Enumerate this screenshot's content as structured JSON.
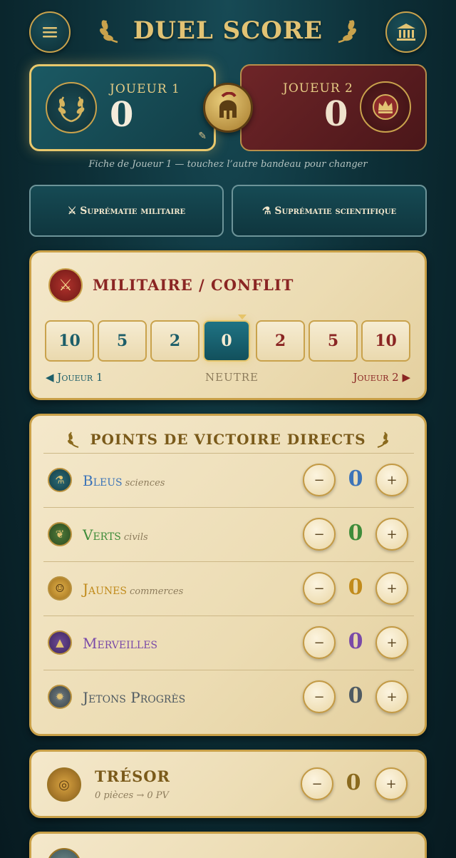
{
  "header": {
    "title": "DUEL SCORE",
    "menu_icon": "menu-icon",
    "museum_icon": "museum-icon"
  },
  "player1": {
    "label": "JOUEUR 1",
    "score": "0"
  },
  "player2": {
    "label": "JOUEUR 2",
    "score": "0"
  },
  "hint": "Fiche de Joueur 1 — touchez l’autre bandeau pour changer",
  "supremacy": {
    "military": "⚔ Suprématie militaire",
    "scientific": "⚗ Suprématie scientifique"
  },
  "military": {
    "title": "MILITAIRE / CONFLIT",
    "track": [
      "10",
      "5",
      "2",
      "0",
      "2",
      "5",
      "10"
    ],
    "selected_index": 3,
    "left_label": "◀ Joueur 1",
    "middle_label": "NEUTRE",
    "right_label": "Joueur 2 ▶"
  },
  "victory": {
    "title": "POINTS DE VICTOIRE DIRECTS",
    "rows": [
      {
        "label": "Bleus",
        "sub": "sciences",
        "value": "0",
        "color": "#3d74b8"
      },
      {
        "label": "Verts",
        "sub": "civils",
        "value": "0",
        "color": "#3f8c3a"
      },
      {
        "label": "Jaunes",
        "sub": "commerces",
        "value": "0",
        "color": "#c18b1c"
      },
      {
        "label": "Merveilles",
        "sub": "",
        "value": "0",
        "color": "#7a4aa8"
      },
      {
        "label": "Jetons Progrès",
        "sub": "",
        "value": "0",
        "color": "#4f5a62"
      }
    ],
    "minus": "−",
    "plus": "+"
  },
  "treasury": {
    "title": "TRÉSOR",
    "sub": "0 pièces → 0 PV",
    "value": "0"
  }
}
